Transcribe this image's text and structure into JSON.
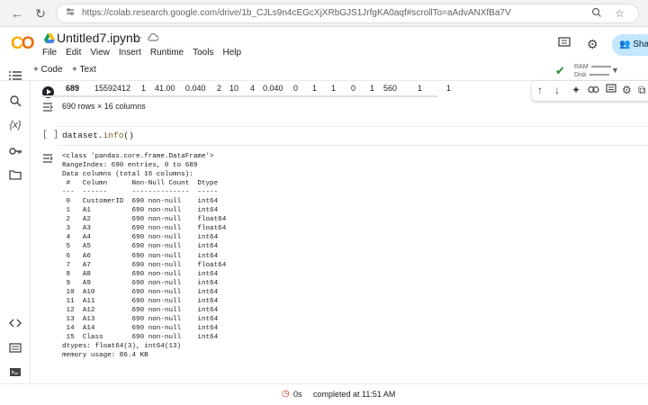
{
  "browser": {
    "url": "https://colab.research.google.com/drive/1b_CJLs9n4cEGcXjXRbGJS1JrfgKA0aqf#scrollTo=aAdvANXfBa7V",
    "back": "←",
    "reload": "↻"
  },
  "header": {
    "logo_a": "C",
    "logo_b": "O",
    "title": "Untitled7.ipynb",
    "menu": [
      "File",
      "Edit",
      "View",
      "Insert",
      "Runtime",
      "Tools",
      "Help"
    ],
    "share": "Sha"
  },
  "toolbar": {
    "add_code": "+ Code",
    "add_text": "+ Text",
    "ram_label": "RAM",
    "disk_label": "Disk"
  },
  "sidebar": {
    "var_label": "{x}"
  },
  "cell1": {
    "last_row": [
      "689",
      "15592412",
      "1",
      "41.00",
      "0.040",
      "2",
      "10",
      "4",
      "0.040",
      "0",
      "1",
      "1",
      "0",
      "1",
      "560",
      "1",
      "1"
    ],
    "row_count": "690 rows × 16 columns"
  },
  "cell2": {
    "bracket": "[ ]",
    "code_obj": "dataset.",
    "code_fn": "info",
    "code_paren": "()",
    "output": "<class 'pandas.core.frame.DataFrame'>\nRangeIndex: 690 entries, 0 to 689\nData columns (total 16 columns):\n #   Column      Non-Null Count  Dtype  \n---  ------      --------------  -----  \n 0   CustomerID  690 non-null    int64  \n 1   A1          690 non-null    int64  \n 2   A2          690 non-null    float64\n 3   A3          690 non-null    float64\n 4   A4          690 non-null    int64  \n 5   A5          690 non-null    int64  \n 6   A6          690 non-null    int64  \n 7   A7          690 non-null    float64\n 8   A8          690 non-null    int64  \n 9   A9          690 non-null    int64  \n 10  A10         690 non-null    int64  \n 11  A11         690 non-null    int64  \n 12  A12         690 non-null    int64  \n 13  A13         690 non-null    int64  \n 14  A14         690 non-null    int64  \n 15  Class       690 non-null    int64  \ndtypes: float64(3), int64(13)\nmemory usage: 86.4 KB"
  },
  "status": {
    "duration": "0s",
    "text": "completed at 11:51 AM"
  }
}
